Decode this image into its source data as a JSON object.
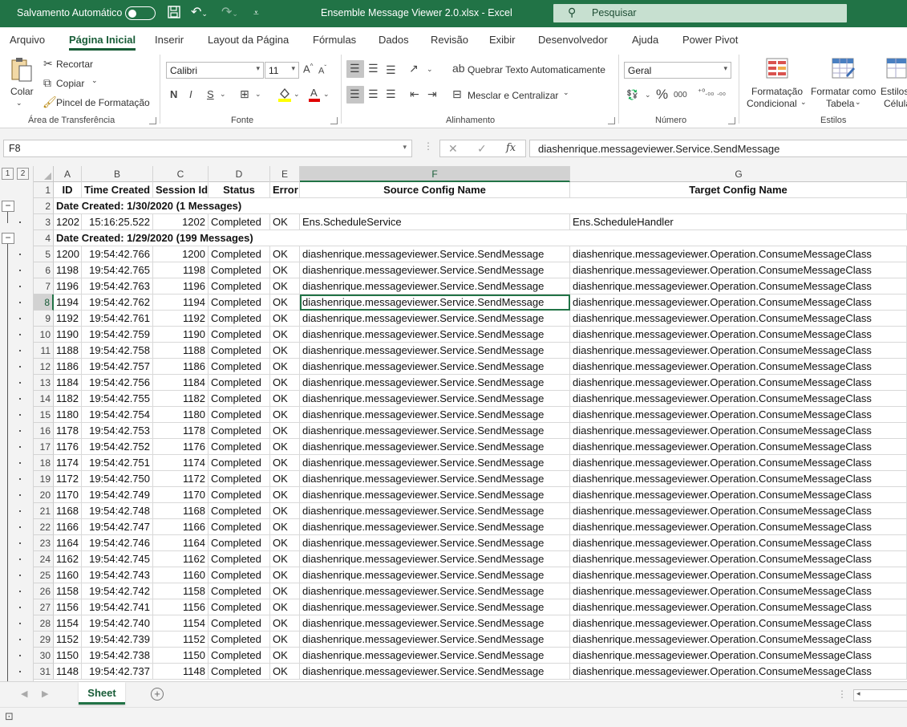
{
  "titlebar": {
    "autosave_label": "Salvamento Automático",
    "title": "Ensemble Message Viewer 2.0.xlsx  -  Excel",
    "search_placeholder": "Pesquisar"
  },
  "tabs": [
    {
      "label": "Arquivo"
    },
    {
      "label": "Página Inicial"
    },
    {
      "label": "Inserir"
    },
    {
      "label": "Layout da Página"
    },
    {
      "label": "Fórmulas"
    },
    {
      "label": "Dados"
    },
    {
      "label": "Revisão"
    },
    {
      "label": "Exibir"
    },
    {
      "label": "Desenvolvedor"
    },
    {
      "label": "Ajuda"
    },
    {
      "label": "Power Pivot"
    }
  ],
  "ribbon": {
    "clipboard": {
      "paste": "Colar",
      "cut": "Recortar",
      "copy": "Copiar",
      "format_painter": "Pincel de Formatação",
      "group": "Área de Transferência"
    },
    "font": {
      "name": "Calibri",
      "size": "11",
      "bold": "N",
      "italic": "I",
      "underline": "S",
      "group": "Fonte"
    },
    "alignment": {
      "wrap": "Quebrar Texto Automaticamente",
      "merge": "Mesclar e Centralizar",
      "group": "Alinhamento"
    },
    "number": {
      "format": "Geral",
      "group": "Número"
    },
    "styles": {
      "conditional_1": "Formatação",
      "conditional_2": "Condicional",
      "table_1": "Formatar como",
      "table_2": "Tabela",
      "cell_1": "Estilos",
      "cell_2": "Célula",
      "group": "Estilos"
    }
  },
  "formula_bar": {
    "name_box": "F8",
    "formula": "diashenrique.messageviewer.Service.SendMessage"
  },
  "outline_levels": [
    "1",
    "2"
  ],
  "columns": [
    "A",
    "B",
    "C",
    "D",
    "E",
    "F",
    "G"
  ],
  "headers": [
    "ID",
    "Time Created",
    "Session Id",
    "Status",
    "Error",
    "Source Config Name",
    "Target Config Name"
  ],
  "group1": {
    "label": "Date Created: 1/30/2020 (1 Messages)",
    "row": {
      "id": "1202",
      "time": "15:16:25.522",
      "session": "1202",
      "status": "Completed",
      "error": "OK",
      "source": "Ens.ScheduleService",
      "target": "Ens.ScheduleHandler"
    }
  },
  "group2_label": "Date Created: 1/29/2020 (199 Messages)",
  "data_rows": [
    {
      "id": "1200",
      "time": "19:54:42.766",
      "session": "1200"
    },
    {
      "id": "1198",
      "time": "19:54:42.765",
      "session": "1198"
    },
    {
      "id": "1196",
      "time": "19:54:42.763",
      "session": "1196"
    },
    {
      "id": "1194",
      "time": "19:54:42.762",
      "session": "1194"
    },
    {
      "id": "1192",
      "time": "19:54:42.761",
      "session": "1192"
    },
    {
      "id": "1190",
      "time": "19:54:42.759",
      "session": "1190"
    },
    {
      "id": "1188",
      "time": "19:54:42.758",
      "session": "1188"
    },
    {
      "id": "1186",
      "time": "19:54:42.757",
      "session": "1186"
    },
    {
      "id": "1184",
      "time": "19:54:42.756",
      "session": "1184"
    },
    {
      "id": "1182",
      "time": "19:54:42.755",
      "session": "1182"
    },
    {
      "id": "1180",
      "time": "19:54:42.754",
      "session": "1180"
    },
    {
      "id": "1178",
      "time": "19:54:42.753",
      "session": "1178"
    },
    {
      "id": "1176",
      "time": "19:54:42.752",
      "session": "1176"
    },
    {
      "id": "1174",
      "time": "19:54:42.751",
      "session": "1174"
    },
    {
      "id": "1172",
      "time": "19:54:42.750",
      "session": "1172"
    },
    {
      "id": "1170",
      "time": "19:54:42.749",
      "session": "1170"
    },
    {
      "id": "1168",
      "time": "19:54:42.748",
      "session": "1168"
    },
    {
      "id": "1166",
      "time": "19:54:42.747",
      "session": "1166"
    },
    {
      "id": "1164",
      "time": "19:54:42.746",
      "session": "1164"
    },
    {
      "id": "1162",
      "time": "19:54:42.745",
      "session": "1162"
    },
    {
      "id": "1160",
      "time": "19:54:42.743",
      "session": "1160"
    },
    {
      "id": "1158",
      "time": "19:54:42.742",
      "session": "1158"
    },
    {
      "id": "1156",
      "time": "19:54:42.741",
      "session": "1156"
    },
    {
      "id": "1154",
      "time": "19:54:42.740",
      "session": "1154"
    },
    {
      "id": "1152",
      "time": "19:54:42.739",
      "session": "1152"
    },
    {
      "id": "1150",
      "time": "19:54:42.738",
      "session": "1150"
    },
    {
      "id": "1148",
      "time": "19:54:42.737",
      "session": "1148"
    }
  ],
  "data_common": {
    "status": "Completed",
    "error": "OK",
    "source": "diashenrique.messageviewer.Service.SendMessage",
    "target": "diashenrique.messageviewer.Operation.ConsumeMessageClass"
  },
  "active_cell_row": 8,
  "sheet": {
    "tab": "Sheet"
  },
  "colors": {
    "excel_green": "#217346",
    "dark_green": "#185c37"
  }
}
